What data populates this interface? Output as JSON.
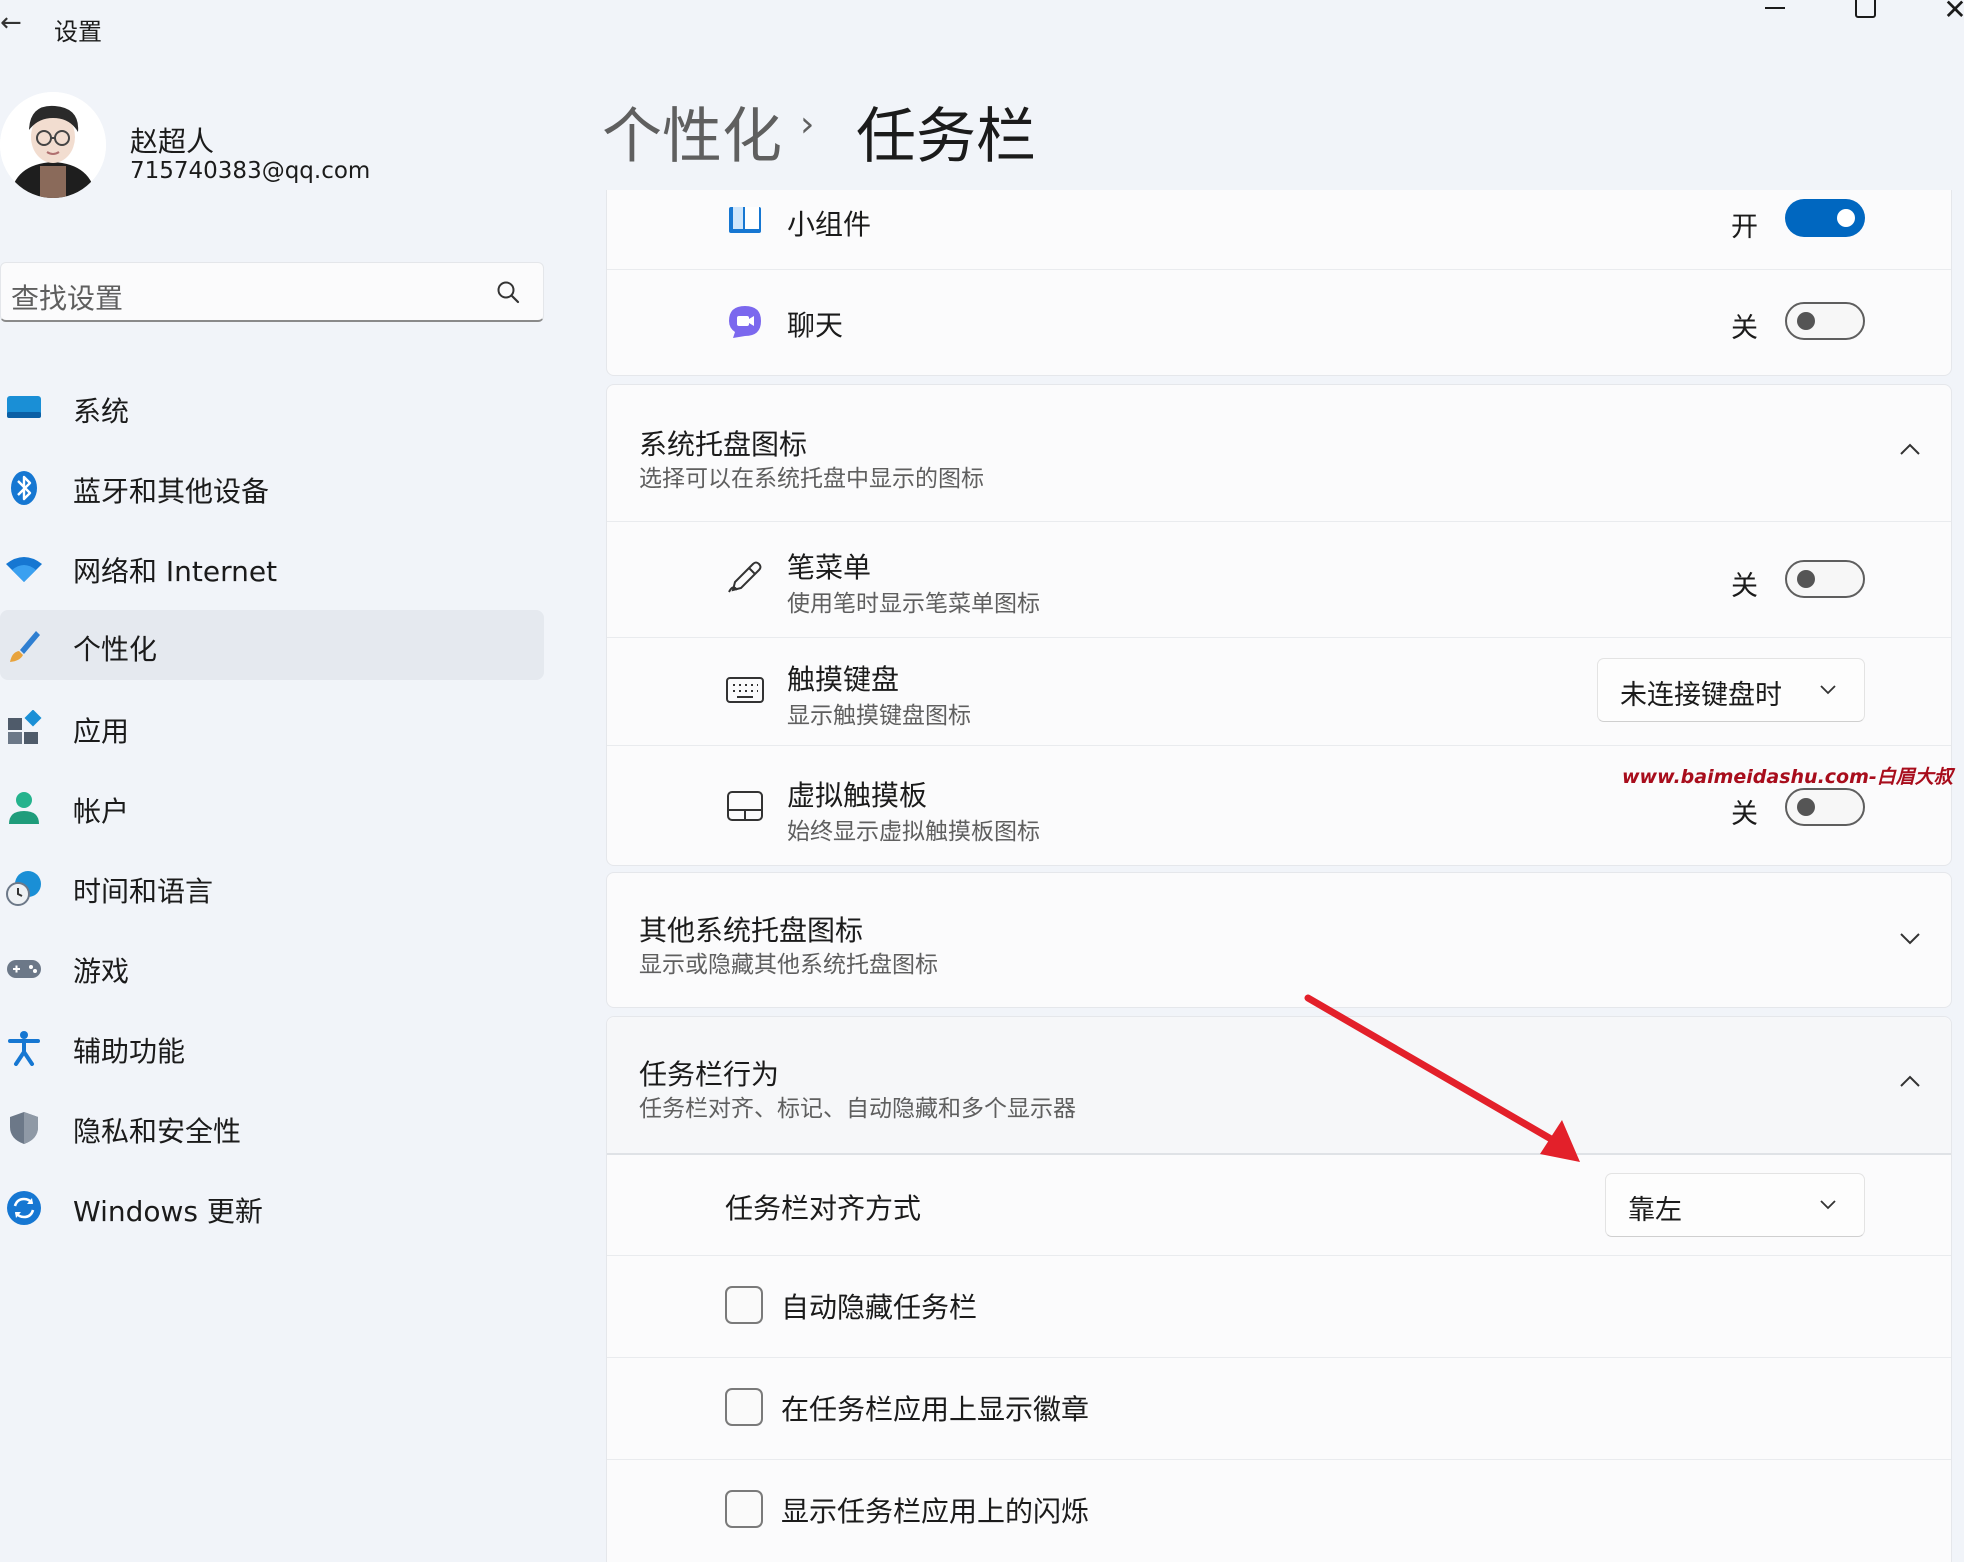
{
  "window": {
    "back_glyph": "←",
    "title": "设置",
    "close_glyph": "✕"
  },
  "profile": {
    "name": "赵超人",
    "email": "715740383@qq.com"
  },
  "search": {
    "placeholder": "查找设置"
  },
  "nav": {
    "items": [
      {
        "label": "系统",
        "icon": "system-display-icon",
        "selected": false
      },
      {
        "label": "蓝牙和其他设备",
        "icon": "bluetooth-icon",
        "selected": false
      },
      {
        "label": "网络和 Internet",
        "icon": "wifi-icon",
        "selected": false
      },
      {
        "label": "个性化",
        "icon": "brush-icon",
        "selected": true
      },
      {
        "label": "应用",
        "icon": "apps-icon",
        "selected": false
      },
      {
        "label": "帐户",
        "icon": "account-icon",
        "selected": false
      },
      {
        "label": "时间和语言",
        "icon": "time-language-icon",
        "selected": false
      },
      {
        "label": "游戏",
        "icon": "gamepad-icon",
        "selected": false
      },
      {
        "label": "辅助功能",
        "icon": "accessibility-icon",
        "selected": false
      },
      {
        "label": "隐私和安全性",
        "icon": "shield-icon",
        "selected": false
      },
      {
        "label": "Windows 更新",
        "icon": "update-icon",
        "selected": false
      }
    ]
  },
  "breadcrumb": {
    "parent": "个性化",
    "separator": "›",
    "current": "任务栏"
  },
  "taskbar_items": {
    "widgets": {
      "label": "小组件",
      "state": "开",
      "on": true
    },
    "chat": {
      "label": "聊天",
      "state": "关",
      "on": false
    }
  },
  "tray_icons": {
    "title": "系统托盘图标",
    "subtitle": "选择可以在系统托盘中显示的图标",
    "expanded": true,
    "pen_menu": {
      "title": "笔菜单",
      "subtitle": "使用笔时显示笔菜单图标",
      "state": "关",
      "on": false
    },
    "touch_keyboard": {
      "title": "触摸键盘",
      "subtitle": "显示触摸键盘图标",
      "value": "未连接键盘时"
    },
    "virtual_touchpad": {
      "title": "虚拟触摸板",
      "subtitle": "始终显示虚拟触摸板图标",
      "state": "关",
      "on": false
    }
  },
  "other_tray": {
    "title": "其他系统托盘图标",
    "subtitle": "显示或隐藏其他系统托盘图标",
    "expanded": false
  },
  "behaviors": {
    "title": "任务栏行为",
    "subtitle": "任务栏对齐、标记、自动隐藏和多个显示器",
    "expanded": true,
    "alignment": {
      "label": "任务栏对齐方式",
      "value": "靠左"
    },
    "checkboxes": [
      {
        "label": "自动隐藏任务栏",
        "checked": false
      },
      {
        "label": "在任务栏应用上显示徽章",
        "checked": false
      },
      {
        "label": "显示任务栏应用上的闪烁",
        "checked": false
      }
    ]
  },
  "watermark": "www.baimeidashu.com-白眉大叔",
  "colors": {
    "accent": "#0067c0",
    "background": "#f1f4f9",
    "card": "#fbfbfc",
    "annotation_arrow": "#e3202a"
  }
}
